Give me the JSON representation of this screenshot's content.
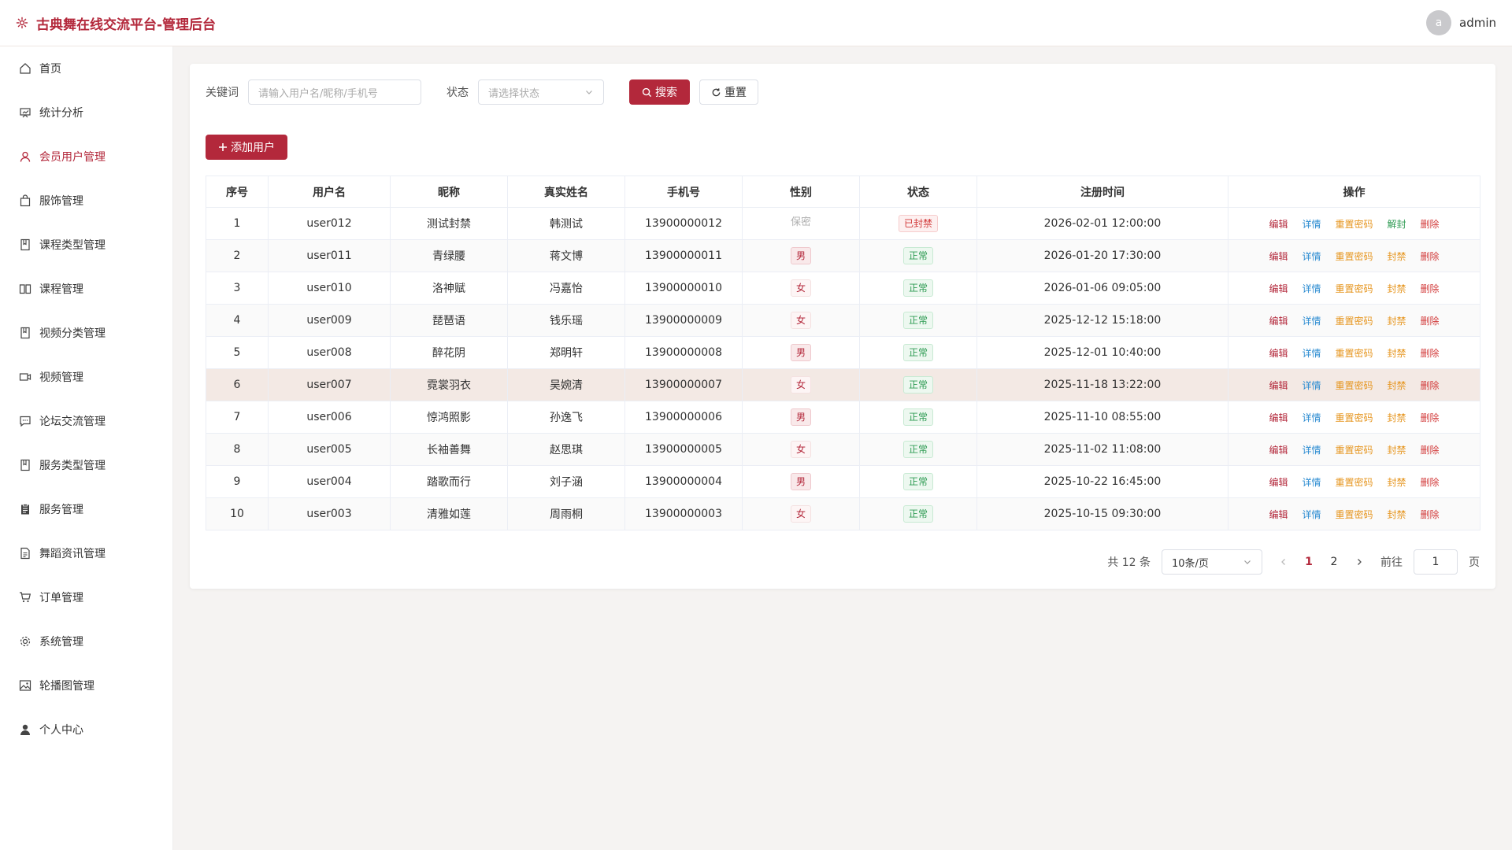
{
  "header": {
    "title": "古典舞在线交流平台-管理后台",
    "avatar_letter": "a",
    "username": "admin"
  },
  "sidebar": {
    "items": [
      {
        "label": "首页",
        "icon": "home-icon"
      },
      {
        "label": "统计分析",
        "icon": "chart-icon"
      },
      {
        "label": "会员用户管理",
        "icon": "user-icon"
      },
      {
        "label": "服饰管理",
        "icon": "bag-icon"
      },
      {
        "label": "课程类型管理",
        "icon": "book-icon"
      },
      {
        "label": "课程管理",
        "icon": "open-book-icon"
      },
      {
        "label": "视频分类管理",
        "icon": "book-icon"
      },
      {
        "label": "视频管理",
        "icon": "video-icon"
      },
      {
        "label": "论坛交流管理",
        "icon": "chat-icon"
      },
      {
        "label": "服务类型管理",
        "icon": "book-icon"
      },
      {
        "label": "服务管理",
        "icon": "clipboard-icon"
      },
      {
        "label": "舞蹈资讯管理",
        "icon": "document-icon"
      },
      {
        "label": "订单管理",
        "icon": "cart-icon"
      },
      {
        "label": "系统管理",
        "icon": "gear-icon"
      },
      {
        "label": "轮播图管理",
        "icon": "picture-icon"
      },
      {
        "label": "个人中心",
        "icon": "person-icon"
      }
    ]
  },
  "filter": {
    "keyword_label": "关键词",
    "keyword_placeholder": "请输入用户名/昵称/手机号",
    "status_label": "状态",
    "status_placeholder": "请选择状态",
    "search_label": "搜索",
    "reset_label": "重置"
  },
  "add_button_label": "添加用户",
  "table": {
    "columns": [
      "序号",
      "用户名",
      "昵称",
      "真实姓名",
      "手机号",
      "性别",
      "状态",
      "注册时间",
      "操作"
    ],
    "rows": [
      {
        "no": "1",
        "username": "user012",
        "nickname": "测试封禁",
        "realname": "韩测试",
        "phone": "13900000012",
        "gender": "保密",
        "status": "已封禁",
        "time": "2026-02-01 12:00:00",
        "toggle": "解封"
      },
      {
        "no": "2",
        "username": "user011",
        "nickname": "青绿腰",
        "realname": "蒋文博",
        "phone": "13900000011",
        "gender": "男",
        "status": "正常",
        "time": "2026-01-20 17:30:00",
        "toggle": "封禁"
      },
      {
        "no": "3",
        "username": "user010",
        "nickname": "洛神赋",
        "realname": "冯嘉怡",
        "phone": "13900000010",
        "gender": "女",
        "status": "正常",
        "time": "2026-01-06 09:05:00",
        "toggle": "封禁"
      },
      {
        "no": "4",
        "username": "user009",
        "nickname": "琵琶语",
        "realname": "钱乐瑶",
        "phone": "13900000009",
        "gender": "女",
        "status": "正常",
        "time": "2025-12-12 15:18:00",
        "toggle": "封禁"
      },
      {
        "no": "5",
        "username": "user008",
        "nickname": "醉花阴",
        "realname": "郑明轩",
        "phone": "13900000008",
        "gender": "男",
        "status": "正常",
        "time": "2025-12-01 10:40:00",
        "toggle": "封禁"
      },
      {
        "no": "6",
        "username": "user007",
        "nickname": "霓裳羽衣",
        "realname": "吴婉清",
        "phone": "13900000007",
        "gender": "女",
        "status": "正常",
        "time": "2025-11-18 13:22:00",
        "toggle": "封禁"
      },
      {
        "no": "7",
        "username": "user006",
        "nickname": "惊鸿照影",
        "realname": "孙逸飞",
        "phone": "13900000006",
        "gender": "男",
        "status": "正常",
        "time": "2025-11-10 08:55:00",
        "toggle": "封禁"
      },
      {
        "no": "8",
        "username": "user005",
        "nickname": "长袖善舞",
        "realname": "赵思琪",
        "phone": "13900000005",
        "gender": "女",
        "status": "正常",
        "time": "2025-11-02 11:08:00",
        "toggle": "封禁"
      },
      {
        "no": "9",
        "username": "user004",
        "nickname": "踏歌而行",
        "realname": "刘子涵",
        "phone": "13900000004",
        "gender": "男",
        "status": "正常",
        "time": "2025-10-22 16:45:00",
        "toggle": "封禁"
      },
      {
        "no": "10",
        "username": "user003",
        "nickname": "清雅如莲",
        "realname": "周雨桐",
        "phone": "13900000003",
        "gender": "女",
        "status": "正常",
        "time": "2025-10-15 09:30:00",
        "toggle": "封禁"
      }
    ],
    "ops": {
      "edit": "编辑",
      "detail": "详情",
      "reset_pwd": "重置密码",
      "delete": "删除"
    }
  },
  "pagination": {
    "total_text": "共 12 条",
    "page_size": "10条/页",
    "pages": [
      "1",
      "2"
    ],
    "current_page": "1",
    "goto_label": "前往",
    "goto_value": "1",
    "page_suffix": "页"
  },
  "colors": {
    "brand": "#b3283b",
    "detail": "#2a8bd1",
    "warning": "#e6951e",
    "success": "#2e9b53",
    "danger": "#d23a3a"
  }
}
